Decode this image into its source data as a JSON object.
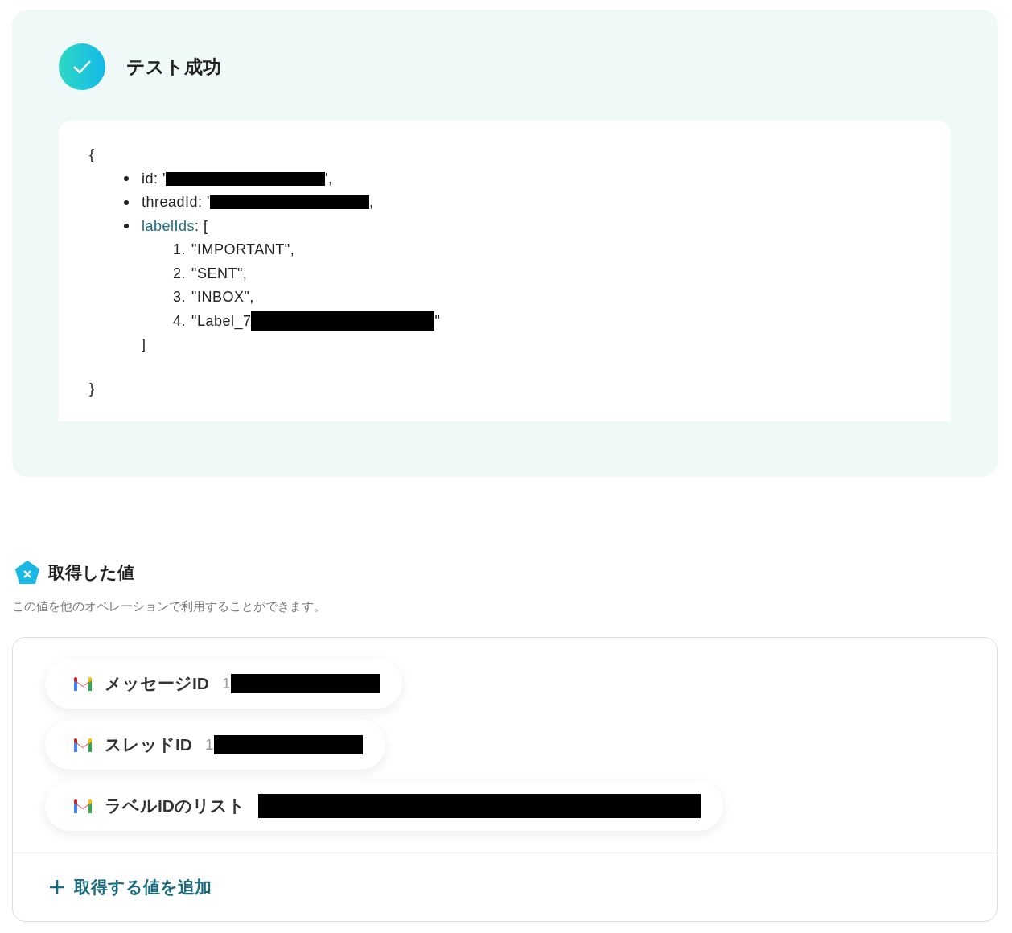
{
  "test_result": {
    "title": "テスト成功",
    "code": {
      "open": "{",
      "close": "}",
      "fields": [
        {
          "key": "id",
          "link": false,
          "separator": ": ",
          "before": "'",
          "after": "',",
          "redacted": true
        },
        {
          "key": "threadId",
          "link": false,
          "separator": ": ",
          "before": "'",
          "after": ",",
          "redacted": true
        },
        {
          "key": "labelIds",
          "link": true,
          "separator": ": ",
          "before": "[",
          "items": [
            {
              "number": "1.",
              "text": "\"IMPORTANT\","
            },
            {
              "number": "2.",
              "text": "\"SENT\","
            },
            {
              "number": "3.",
              "text": "\"INBOX\","
            },
            {
              "number": "4.",
              "text": "\"Label_7",
              "after": "\"",
              "redacted": true
            }
          ],
          "close": "]"
        }
      ]
    }
  },
  "acquired_values": {
    "title": "取得した値",
    "description": "この値を他のオペレーションで利用することができます。",
    "values": [
      {
        "name": "メッセージID",
        "value": "1",
        "redacted": true
      },
      {
        "name": "スレッドID",
        "value": "1",
        "redacted": true
      },
      {
        "name": "ラベルIDのリスト",
        "redacted": true
      }
    ],
    "add_button": "取得する値を追加"
  }
}
